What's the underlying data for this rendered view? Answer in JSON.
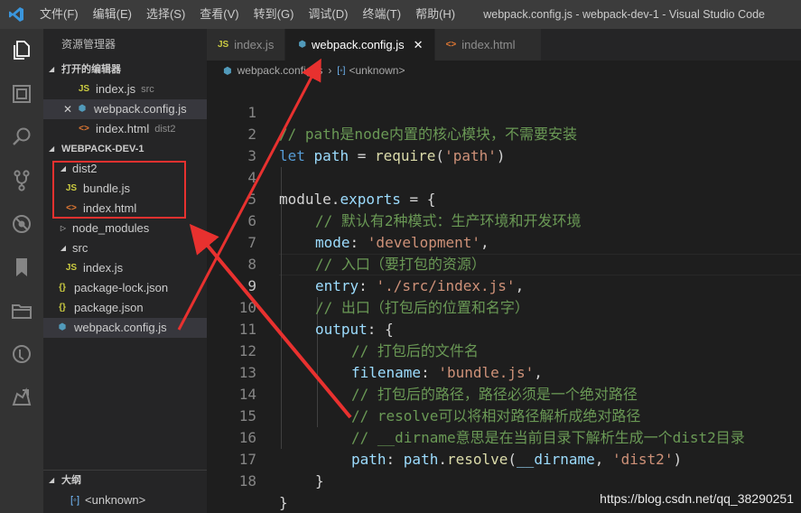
{
  "menu": [
    "文件(F)",
    "编辑(E)",
    "选择(S)",
    "查看(V)",
    "转到(G)",
    "调试(D)",
    "终端(T)",
    "帮助(H)"
  ],
  "window_title": "webpack.config.js - webpack-dev-1 - Visual Studio Code",
  "sidebar": {
    "title": "资源管理器",
    "open_editors_label": "打开的编辑器",
    "open_editors": [
      {
        "name": "index.js",
        "desc": "src",
        "icon": "JS"
      },
      {
        "name": "webpack.config.js",
        "desc": "",
        "icon": "wp",
        "close": "✕"
      },
      {
        "name": "index.html",
        "desc": "dist2",
        "icon": "<>"
      }
    ],
    "project_label": "WEBPACK-DEV-1",
    "tree": {
      "dist2": "dist2",
      "bundle": "bundle.js",
      "index_html": "index.html",
      "node_modules": "node_modules",
      "src": "src",
      "index_js": "index.js",
      "package_lock": "package-lock.json",
      "package_json": "package.json",
      "webpack_config": "webpack.config.js"
    },
    "outline_label": "大纲",
    "outline_item": "<unknown>"
  },
  "tabs": [
    {
      "label": "index.js",
      "icon": "JS"
    },
    {
      "label": "webpack.config.js",
      "icon": "wp",
      "close": "✕"
    },
    {
      "label": "index.html",
      "icon": "<>"
    }
  ],
  "breadcrumb": {
    "file": "webpack.config.js",
    "sep": "›",
    "symbol": "<unknown>"
  },
  "icons": {
    "js": "JS",
    "html": "<>",
    "json": "{}"
  },
  "editor": {
    "current_line": 9,
    "line_numbers": [
      "1",
      "2",
      "3",
      "4",
      "5",
      "6",
      "7",
      "8",
      "9",
      "10",
      "11",
      "12",
      "13",
      "14",
      "15",
      "16",
      "17",
      "18"
    ],
    "tokens": {
      "l1": "// path是node内置的核心模块，不需要安装",
      "l2_let": "let",
      "l2_path": "path",
      "l2_eq": " = ",
      "l2_req": "require",
      "l2_str": "'path'",
      "l4_mod": "module",
      "l4_exp": "exports",
      "l4_rest": " = {",
      "l5": "// 默认有2种模式：生产环境和开发环境",
      "l6_key": "mode",
      "l6_str": "'development'",
      "l7": "// 入口（要打包的资源）",
      "l8_key": "entry",
      "l8_str": "'./src/index.js'",
      "l9": "// 出口（打包后的位置和名字）",
      "l10_key": "output",
      "l11": "// 打包后的文件名",
      "l12_key": "filename",
      "l12_str": "'bundle.js'",
      "l13": "// 打包后的路径，路径必须是一个绝对路径",
      "l14": "// resolve可以将相对路径解析成绝对路径",
      "l15": "// __dirname意思是在当前目录下解析生成一个dist2目录",
      "l16_key": "path",
      "l16_obj": "path",
      "l16_fn": "resolve",
      "l16_dir": "__dirname",
      "l16_str": "'dist2'",
      "l17": "}",
      "l18": "}"
    }
  },
  "watermark": "https://blog.csdn.net/qq_38290251",
  "colors": {
    "annotation": "#e8312f",
    "accent": "#007acc"
  }
}
